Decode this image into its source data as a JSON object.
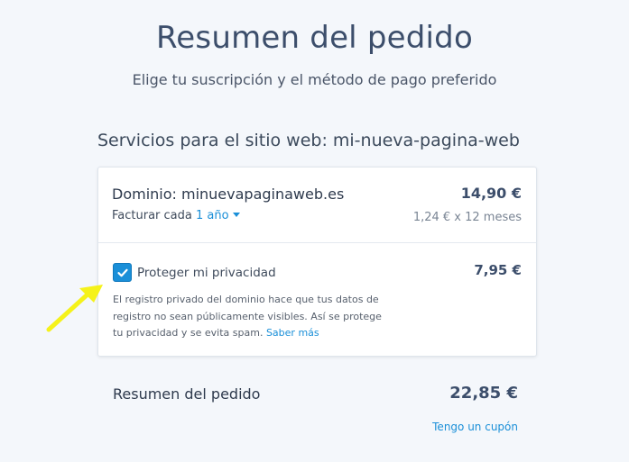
{
  "header": {
    "title": "Resumen del pedido",
    "subtitle": "Elige tu suscripción y el método de pago preferido"
  },
  "services": {
    "title": "Servicios para el sitio web: mi-nueva-pagina-web",
    "domain": {
      "label": "Dominio: minuevapaginaweb.es",
      "billing_prefix": "Facturar cada",
      "billing_period": "1 año",
      "price": "14,90 €",
      "price_detail": "1,24 € x 12 meses"
    },
    "privacy": {
      "checked": true,
      "label": "Proteger mi privacidad",
      "price": "7,95 €",
      "description": "El registro privado del dominio hace que tus datos de registro no sean públicamente visibles. Así se protege tu privacidad y se evita spam.",
      "learn_more": "Saber más"
    }
  },
  "summary": {
    "label": "Resumen del pedido",
    "total": "22,85 €",
    "coupon": "Tengo un cupón"
  },
  "colors": {
    "accent": "#1a8fd8",
    "annotation_arrow": "#f5f21a",
    "background": "#f4f7fb"
  },
  "icons": {
    "checkbox": "check-icon",
    "billing_dropdown": "caret-down-icon",
    "annotation": "arrow-icon"
  }
}
